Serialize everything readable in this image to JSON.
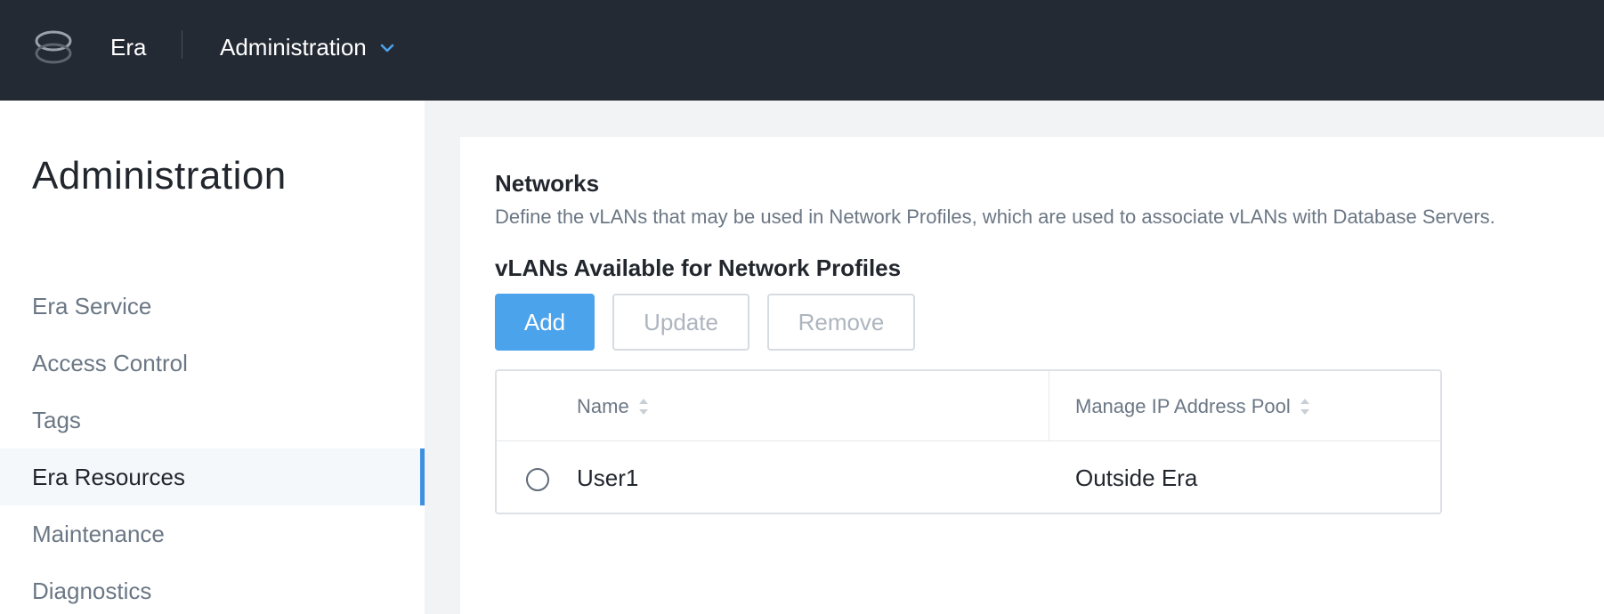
{
  "header": {
    "app_name": "Era",
    "module": "Administration"
  },
  "sidebar": {
    "title": "Administration",
    "items": [
      {
        "label": "Era Service",
        "active": false
      },
      {
        "label": "Access Control",
        "active": false
      },
      {
        "label": "Tags",
        "active": false
      },
      {
        "label": "Era Resources",
        "active": true
      },
      {
        "label": "Maintenance",
        "active": false
      },
      {
        "label": "Diagnostics",
        "active": false
      }
    ]
  },
  "main": {
    "section_title": "Networks",
    "section_description": "Define the vLANs that may be used in Network Profiles, which are used to associate vLANs with Database Servers.",
    "subsection_title": "vLANs Available for Network Profiles",
    "buttons": {
      "add": "Add",
      "update": "Update",
      "remove": "Remove"
    },
    "table": {
      "columns": [
        "Name",
        "Manage IP Address Pool"
      ],
      "rows": [
        {
          "name": "User1",
          "pool": "Outside Era",
          "selected": false
        }
      ]
    }
  },
  "colors": {
    "topbar": "#242a34",
    "accent": "#4ba3ec",
    "active_indicator": "#3f8fe0",
    "muted_text": "#6b7785"
  },
  "icons": {
    "logo": "era-logo-icon",
    "module_chevron": "chevron-down-icon",
    "sort": "sort-icon"
  }
}
